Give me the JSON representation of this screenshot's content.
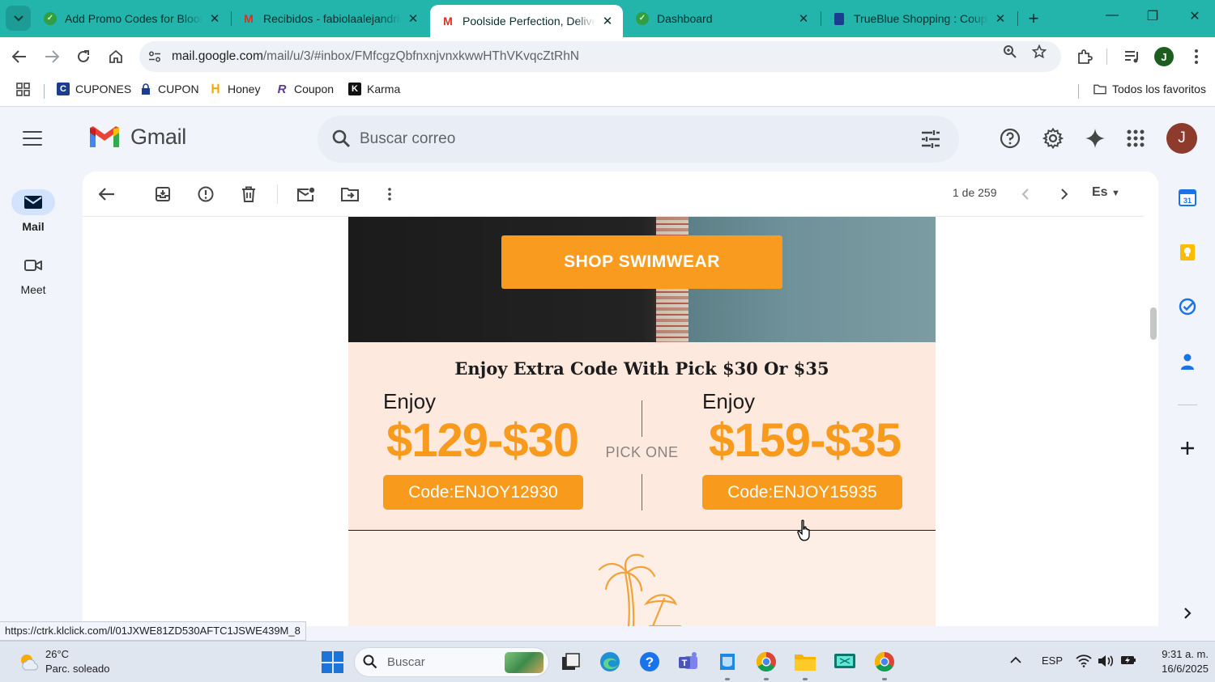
{
  "browser": {
    "tabs": [
      {
        "title": "Add Promo Codes for Bloom",
        "icon": "green-extension-icon"
      },
      {
        "title": "Recibidos - fabiolaalejandria",
        "icon": "gmail-icon"
      },
      {
        "title": "Poolside Perfection, Delivered",
        "icon": "gmail-icon",
        "active": true
      },
      {
        "title": "Dashboard",
        "icon": "green-extension-icon"
      },
      {
        "title": "TrueBlue Shopping : Coupon",
        "icon": "trueblue-icon"
      }
    ],
    "url_host": "mail.google.com",
    "url_path": "/mail/u/3/#inbox/FMfcgzQbfnxnjvnxkwwHThVKvqcZtRhN",
    "profile_initial": "J"
  },
  "bookmarks": {
    "items": [
      {
        "label": "CUPONES"
      },
      {
        "label": "CUPON"
      },
      {
        "label": "Honey"
      },
      {
        "label": "Coupon"
      },
      {
        "label": "Karma"
      }
    ],
    "all_label": "Todos los favoritos"
  },
  "gmail": {
    "brand": "Gmail",
    "search_placeholder": "Buscar correo",
    "avatar_initial": "J",
    "nav": [
      {
        "label": "Mail"
      },
      {
        "label": "Meet"
      }
    ],
    "pager": "1 de 259",
    "lang": "Es"
  },
  "email": {
    "hero_button": "SHOP SWIMWEAR",
    "promo_title": "Enjoy  Extra Code With Pick $30 Or $35",
    "left": {
      "enjoy": "Enjoy",
      "price": "$129-$30",
      "code": "Code:ENJOY12930"
    },
    "right": {
      "enjoy": "Enjoy",
      "price": "$159-$35",
      "code": "Code:ENJOY15935"
    },
    "pick_label": "PICK ONE",
    "accent_color": "#f89a1c"
  },
  "status_url": "https://ctrk.klclick.com/l/01JXWE81ZD530AFTC1JSWE439M_8",
  "taskbar": {
    "temperature": "26°C",
    "weather": "Parc. soleado",
    "search_label": "Buscar",
    "lang": "ESP",
    "time": "9:31 a. m.",
    "date": "16/6/2025"
  }
}
